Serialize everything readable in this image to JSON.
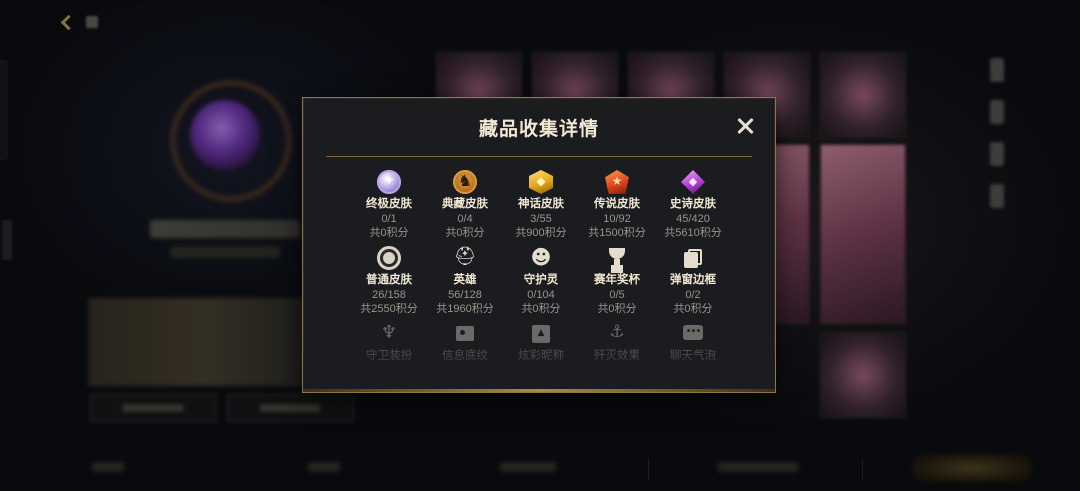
{
  "modal": {
    "title": "藏品收集详情",
    "close_icon": "close-icon"
  },
  "categories": [
    {
      "label": "终极皮肤",
      "count": "0/1",
      "points": "共0积分",
      "icon": "ultimate-skin-icon",
      "color": "#b7a6e6"
    },
    {
      "label": "典藏皮肤",
      "count": "0/4",
      "points": "共0积分",
      "icon": "classic-skin-icon",
      "color": "#d89a3c"
    },
    {
      "label": "神话皮肤",
      "count": "3/55",
      "points": "共900积分",
      "icon": "myth-skin-icon",
      "color": "#e3a714"
    },
    {
      "label": "传说皮肤",
      "count": "10/92",
      "points": "共1500积分",
      "icon": "legend-skin-icon",
      "color": "#e0461a"
    },
    {
      "label": "史诗皮肤",
      "count": "45/420",
      "points": "共5610积分",
      "icon": "epic-skin-icon",
      "color": "#b03ed6"
    },
    {
      "label": "普通皮肤",
      "count": "26/158",
      "points": "共2550积分",
      "icon": "normal-skin-icon"
    },
    {
      "label": "英雄",
      "count": "56/128",
      "points": "共1960积分",
      "icon": "hero-helmet-icon"
    },
    {
      "label": "守护灵",
      "count": "0/104",
      "points": "共0积分",
      "icon": "guardian-spirit-icon"
    },
    {
      "label": "赛年奖杯",
      "count": "0/5",
      "points": "共0积分",
      "icon": "trophy-icon"
    },
    {
      "label": "弹窗边框",
      "count": "0/2",
      "points": "共0积分",
      "icon": "popup-frame-icon"
    },
    {
      "label": "守卫装扮",
      "icon": "ward-skin-icon"
    },
    {
      "label": "信息底纹",
      "icon": "info-card-icon"
    },
    {
      "label": "炫彩昵称",
      "icon": "colorful-name-icon"
    },
    {
      "label": "歼灭效果",
      "icon": "kill-effect-icon"
    },
    {
      "label": "聊天气泡",
      "icon": "chat-bubble-icon"
    }
  ],
  "colors": {
    "modal_border": "#8d7640",
    "modal_bg": "#1a1c20",
    "title_text": "#f2e9d4"
  }
}
